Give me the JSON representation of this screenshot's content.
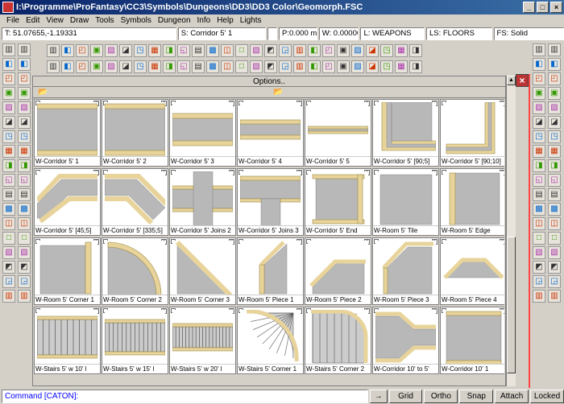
{
  "window": {
    "title": "I:\\Programme\\ProFantasy\\CC3\\Symbols\\Dungeons\\DD3\\DD3 Color\\Geomorph.FSC"
  },
  "menu": [
    "File",
    "Edit",
    "View",
    "Draw",
    "Tools",
    "Symbols",
    "Dungeon",
    "Info",
    "Help",
    "Lights"
  ],
  "status": {
    "coords": "T: 51.07655,-1.19331",
    "symbol": "S: Corridor 5' 1",
    "pen": "P:0.000 mm",
    "width": "W: 0.00000",
    "layer": "L: WEAPONS",
    "linestyle": "LS: FLOORS",
    "fillstyle": "FS: Solid"
  },
  "catalog": {
    "options_label": "Options..",
    "items": [
      {
        "label": "W-Corridor 5' 1",
        "shape": "h-wide"
      },
      {
        "label": "W-Corridor 5' 2",
        "shape": "h-wide"
      },
      {
        "label": "W-Corridor 5' 3",
        "shape": "h-mid"
      },
      {
        "label": "W-Corridor 5' 4",
        "shape": "h-narrow"
      },
      {
        "label": "W-Corridor 5' 5",
        "shape": "h-thin"
      },
      {
        "label": "W-Corridor 5' [90;5]",
        "shape": "corner"
      },
      {
        "label": "W-Corridor 5' [90;10]",
        "shape": "corner2"
      },
      {
        "label": "W-Corridor 5' [45;5]",
        "shape": "diag"
      },
      {
        "label": "W-Corridor 5' [335;5]",
        "shape": "diag2"
      },
      {
        "label": "W-Corridor 5' Joins 2",
        "shape": "cross"
      },
      {
        "label": "W-Corridor 5' Joins 3",
        "shape": "tee"
      },
      {
        "label": "W-Corridor 5' End",
        "shape": "end"
      },
      {
        "label": "W-Room 5' Tile",
        "shape": "tile"
      },
      {
        "label": "W-Room 5' Edge",
        "shape": "edge"
      },
      {
        "label": "W-Room 5' Corner 1",
        "shape": "rcorner"
      },
      {
        "label": "W-Room 5' Corner 2",
        "shape": "rround"
      },
      {
        "label": "W-Room 5' Corner 3",
        "shape": "rtri"
      },
      {
        "label": "W-Room 5' Piece 1",
        "shape": "p1"
      },
      {
        "label": "W-Room 5' Piece 2",
        "shape": "p2"
      },
      {
        "label": "W-Room 5' Piece 3",
        "shape": "p3"
      },
      {
        "label": "W-Room 5' Piece 4",
        "shape": "p4"
      },
      {
        "label": "W-Stairs 5' w 10' l",
        "shape": "stairs"
      },
      {
        "label": "W-Stairs 5' w 15' l",
        "shape": "stairs2"
      },
      {
        "label": "W-Stairs 5' w 20' l",
        "shape": "stairs3"
      },
      {
        "label": "W-Stairs 5' Corner 1",
        "shape": "scorner"
      },
      {
        "label": "W-Stairs 5' Corner 2",
        "shape": "scorner2"
      },
      {
        "label": "W-Corridor 10' to 5'",
        "shape": "taper"
      },
      {
        "label": "W-Corridor 10' 1",
        "shape": "wide10"
      }
    ]
  },
  "command": {
    "prompt": "Command [CATON]:"
  },
  "buttons": {
    "arrow": "→",
    "grid": "Grid",
    "ortho": "Ortho",
    "snap": "Snap",
    "attach": "Attach",
    "locked": "Locked"
  },
  "colors": {
    "wall": "#e8d49a",
    "floor": "#b8b8b8",
    "title": "#0a246a"
  }
}
